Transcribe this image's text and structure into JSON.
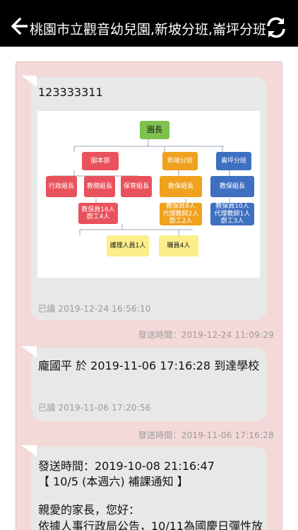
{
  "header": {
    "title": "桃園市立觀音幼兒園,新坡分班,崙坪分班",
    "back_icon": "arrow-left-icon",
    "refresh_icon": "refresh-icon"
  },
  "messages": [
    {
      "text": "123333311",
      "read": "已讀 2019-12-24 16:56:10",
      "sent": "發送時間：2019-12-24 11:09:29",
      "org_chart": {
        "top": "園長",
        "branches": [
          "園本部",
          "新坡分班",
          "崙坪分班"
        ],
        "groups": [
          "行政組長",
          "教務組長",
          "保育組長",
          "教保組長",
          "教保組長"
        ],
        "staff": [
          [
            "教保員16人",
            "廚工4人"
          ],
          [
            "教保員8人",
            "代理教師2人",
            "廚工2人"
          ],
          [
            "教保員10人",
            "代理教師1人",
            "廚工3人"
          ]
        ],
        "support": [
          "護理人員1人",
          "職員4人"
        ]
      }
    },
    {
      "text": "龐國平 於 2019-11-06 17:16:28 到達學校",
      "read": "已讀 2019-11-06 17:20:56",
      "sent": "發送時間：2019-11-06 17:16:28"
    },
    {
      "line1": "發送時間：2019-10-08 21:16:47",
      "line2": "【 10/5 (本週六) 補課通知 】",
      "line3": "親愛的家長，您好：",
      "line4": "依據人事行政局公告，10/11為國慶日彈性放"
    }
  ],
  "colors": {
    "header_bg": "#000000",
    "panel_bg": "#f4d9d9",
    "bubble_bg": "#e8e8e8",
    "meta_text": "#9a9a9a"
  }
}
